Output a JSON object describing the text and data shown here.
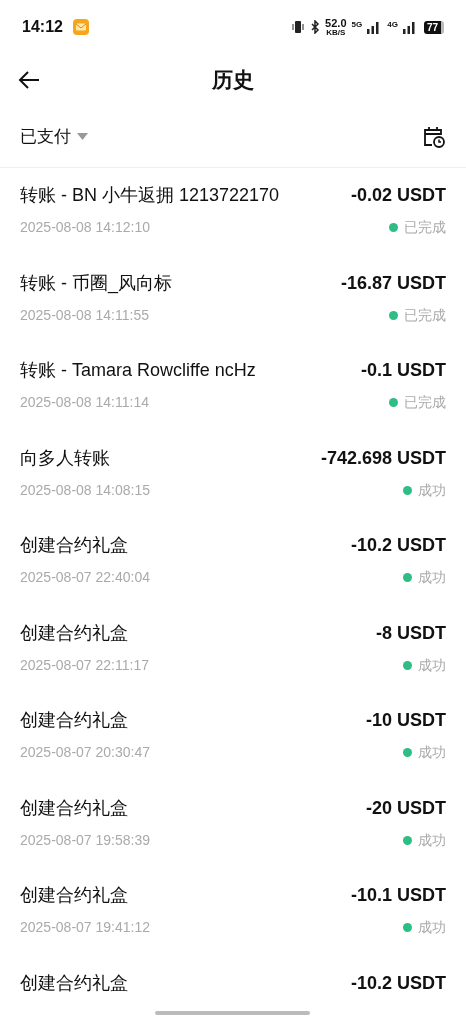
{
  "status_bar": {
    "time": "14:12",
    "net_speed": "52.0",
    "net_unit": "KB/S",
    "net1": "5G",
    "net2": "4G",
    "battery": "77"
  },
  "header": {
    "title": "历史"
  },
  "filter": {
    "label": "已支付"
  },
  "transactions": [
    {
      "title": "转账 - BN 小牛返拥 1213722170",
      "amount": "-0.02 USDT",
      "time": "2025-08-08 14:12:10",
      "status": "已完成",
      "color": "#2ebd85"
    },
    {
      "title": "转账 - 币圈_风向标",
      "amount": "-16.87 USDT",
      "time": "2025-08-08 14:11:55",
      "status": "已完成",
      "color": "#2ebd85"
    },
    {
      "title": "转账 - Tamara Rowcliffe ncHz",
      "amount": "-0.1 USDT",
      "time": "2025-08-08 14:11:14",
      "status": "已完成",
      "color": "#2ebd85"
    },
    {
      "title": "向多人转账",
      "amount": "-742.698 USDT",
      "time": "2025-08-08 14:08:15",
      "status": "成功",
      "color": "#2ebd85"
    },
    {
      "title": "创建合约礼盒",
      "amount": "-10.2 USDT",
      "time": "2025-08-07 22:40:04",
      "status": "成功",
      "color": "#2ebd85"
    },
    {
      "title": "创建合约礼盒",
      "amount": "-8 USDT",
      "time": "2025-08-07 22:11:17",
      "status": "成功",
      "color": "#2ebd85"
    },
    {
      "title": "创建合约礼盒",
      "amount": "-10 USDT",
      "time": "2025-08-07 20:30:47",
      "status": "成功",
      "color": "#2ebd85"
    },
    {
      "title": "创建合约礼盒",
      "amount": "-20 USDT",
      "time": "2025-08-07 19:58:39",
      "status": "成功",
      "color": "#2ebd85"
    },
    {
      "title": "创建合约礼盒",
      "amount": "-10.1 USDT",
      "time": "2025-08-07 19:41:12",
      "status": "成功",
      "color": "#2ebd85"
    },
    {
      "title": "创建合约礼盒",
      "amount": "-10.2 USDT"
    }
  ]
}
